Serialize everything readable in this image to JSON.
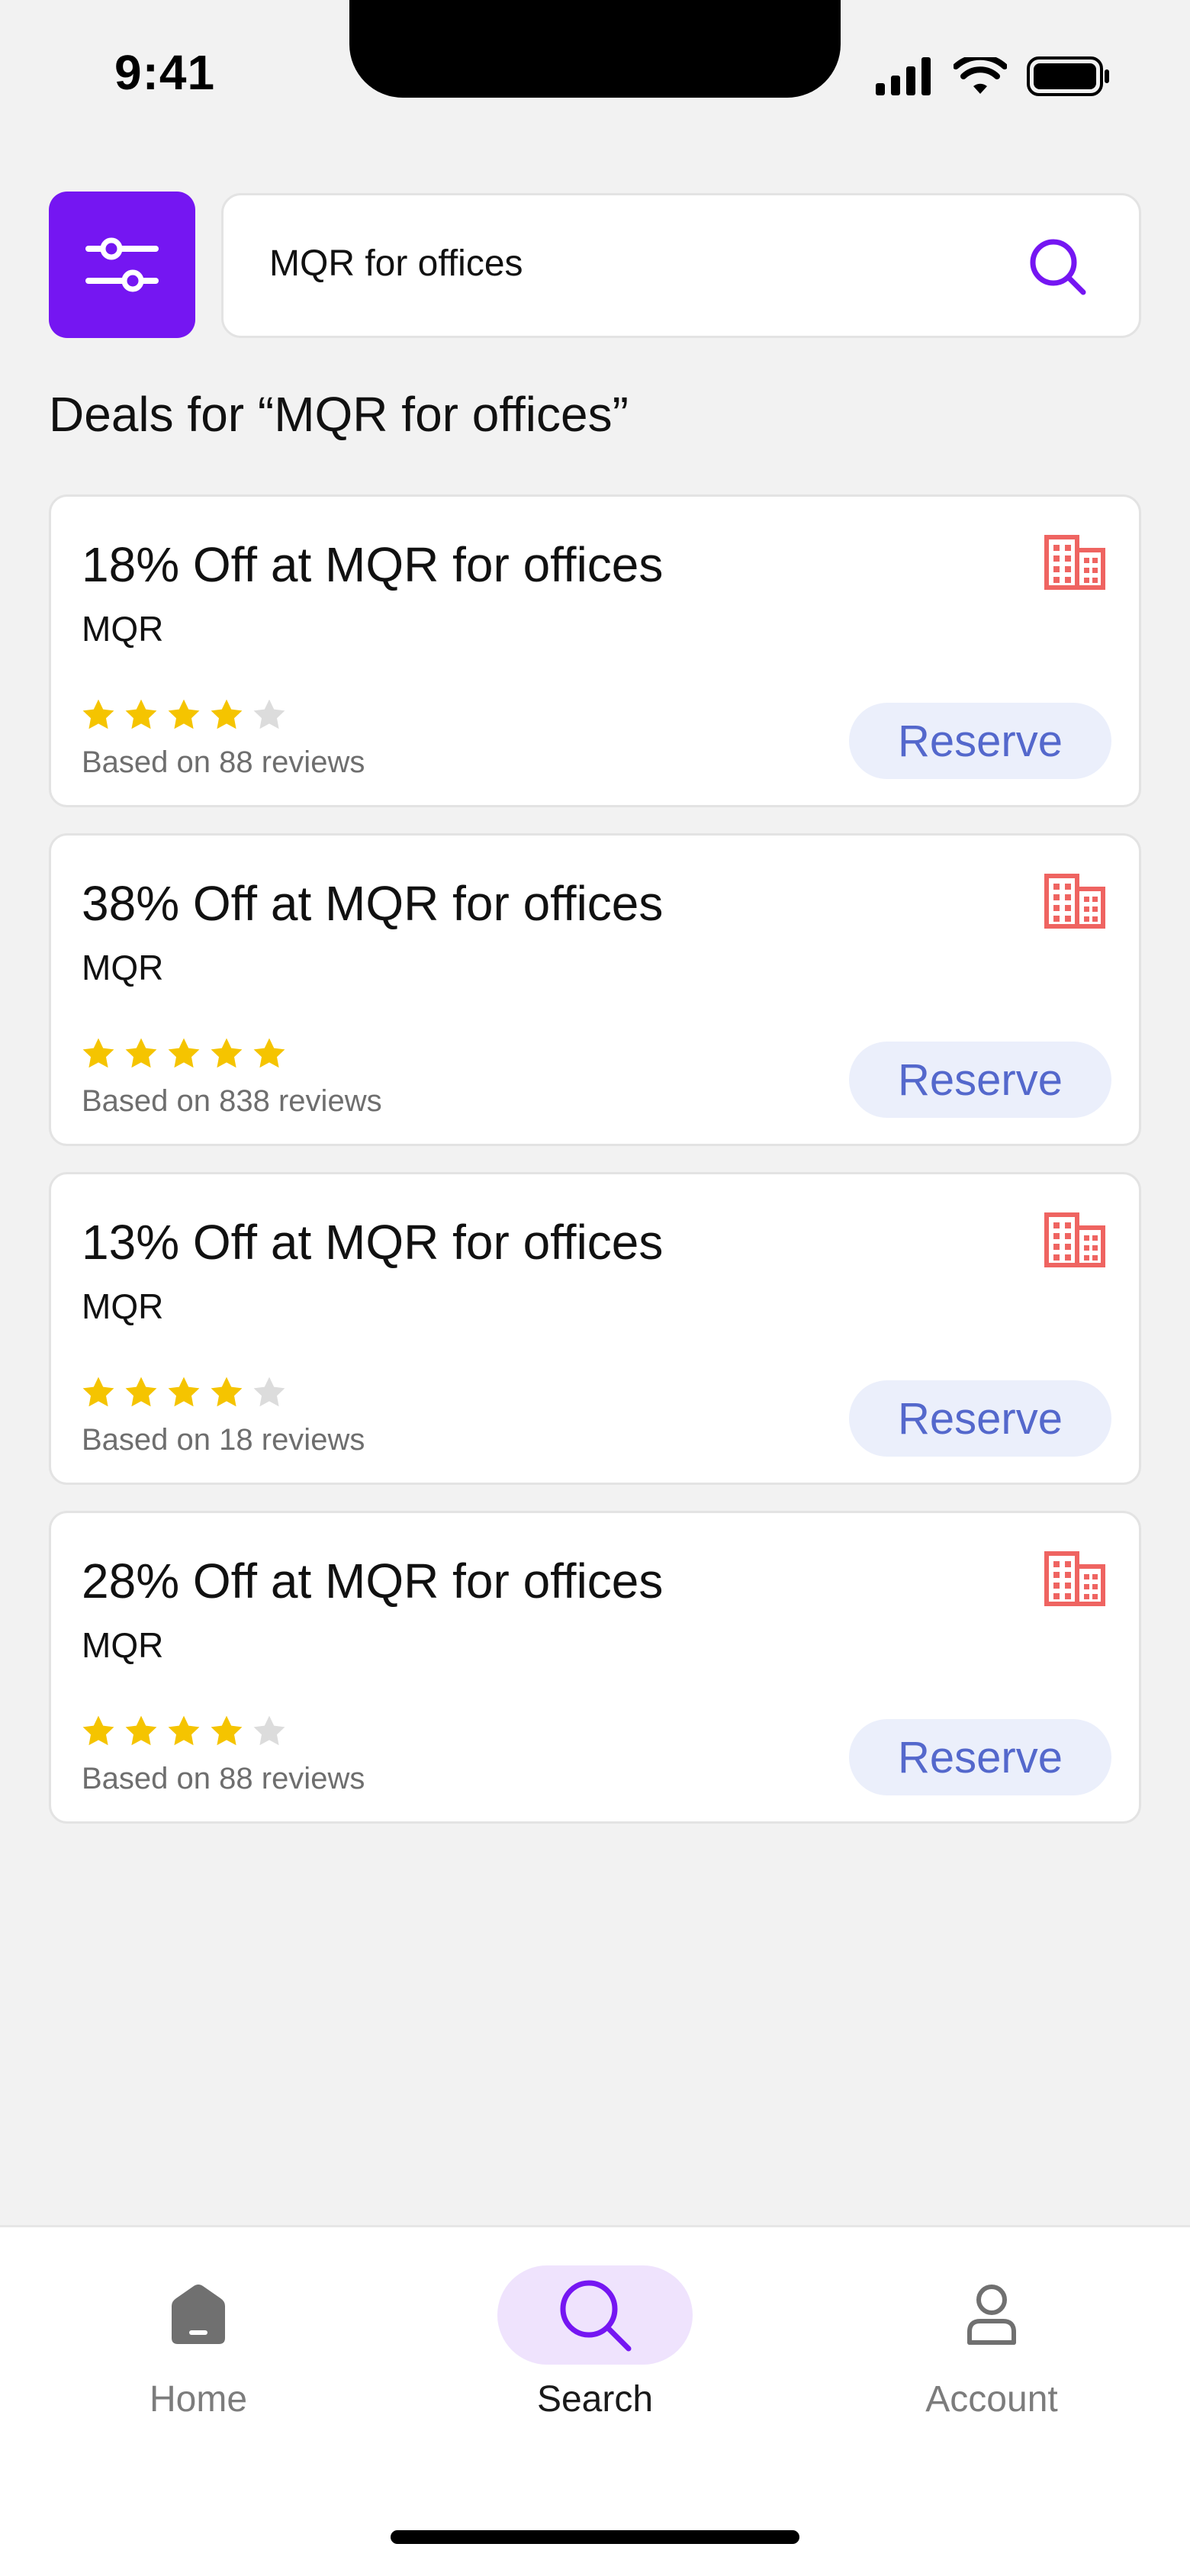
{
  "status_bar": {
    "time": "9:41"
  },
  "search": {
    "query": "MQR for offices"
  },
  "results": {
    "heading": "Deals for “MQR for offices”"
  },
  "colors": {
    "accent": "#7516f2",
    "star": "#f5c400",
    "star_empty": "#dcdcdc",
    "building": "#ef6461",
    "reserve_bg": "#ebeffb",
    "reserve_text": "#5468cc"
  },
  "deals": [
    {
      "title": "18% Off at MQR for offices",
      "brand": "MQR",
      "rating": 4,
      "reviews": "Based on 88 reviews",
      "button": "Reserve",
      "icon": "building-icon"
    },
    {
      "title": "38% Off at MQR for offices",
      "brand": "MQR",
      "rating": 5,
      "reviews": "Based on 838 reviews",
      "button": "Reserve",
      "icon": "building-icon"
    },
    {
      "title": "13% Off at MQR for offices",
      "brand": "MQR",
      "rating": 4,
      "reviews": "Based on 18 reviews",
      "button": "Reserve",
      "icon": "building-icon"
    },
    {
      "title": "28% Off at MQR for offices",
      "brand": "MQR",
      "rating": 4,
      "reviews": "Based on 88 reviews",
      "button": "Reserve",
      "icon": "building-icon"
    }
  ],
  "nav": {
    "items": [
      {
        "label": "Home",
        "icon": "home-icon",
        "active": false
      },
      {
        "label": "Search",
        "icon": "search-icon",
        "active": true
      },
      {
        "label": "Account",
        "icon": "account-icon",
        "active": false
      }
    ]
  }
}
